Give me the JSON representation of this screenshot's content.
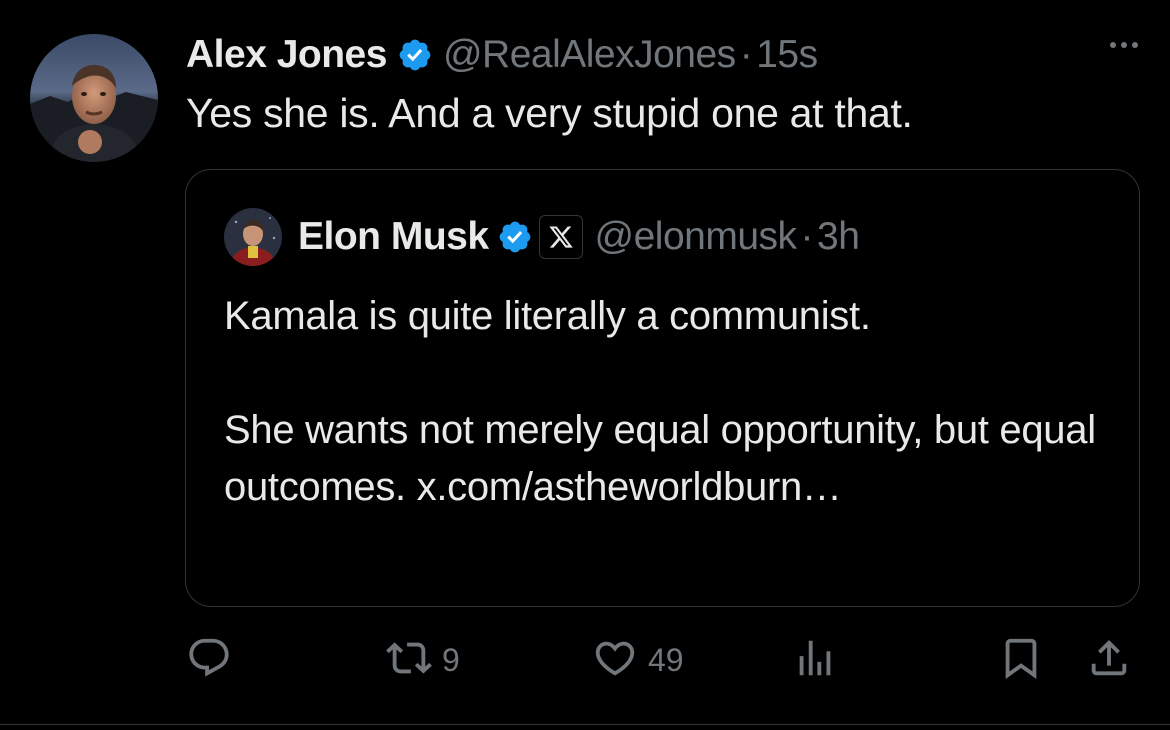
{
  "tweet": {
    "author_name": "Alex Jones",
    "author_handle": "@RealAlexJones",
    "separator": "·",
    "time": "15s",
    "text": "Yes she is. And a very stupid one at that."
  },
  "quoted_tweet": {
    "author_name": "Elon Musk",
    "author_handle": "@elonmusk",
    "separator": "·",
    "time": "3h",
    "paragraph_1": "Kamala is quite literally a communist.",
    "paragraph_2": "She wants not merely equal opportunity, but equal outcomes. x.com/astheworldburn…"
  },
  "actions": {
    "reply_count": "",
    "repost_count": "9",
    "like_count": "49"
  },
  "icons": {
    "verified": "verified-badge-icon",
    "affiliation": "x-logo-icon",
    "more": "more-icon",
    "reply": "reply-icon",
    "repost": "repost-icon",
    "like": "heart-icon",
    "views": "analytics-icon",
    "bookmark": "bookmark-icon",
    "share": "share-icon"
  },
  "colors": {
    "background": "#000000",
    "text_primary": "#e7e9ea",
    "text_secondary": "#71767b",
    "verified_blue": "#1d9bf0",
    "border": "#2f3336"
  }
}
